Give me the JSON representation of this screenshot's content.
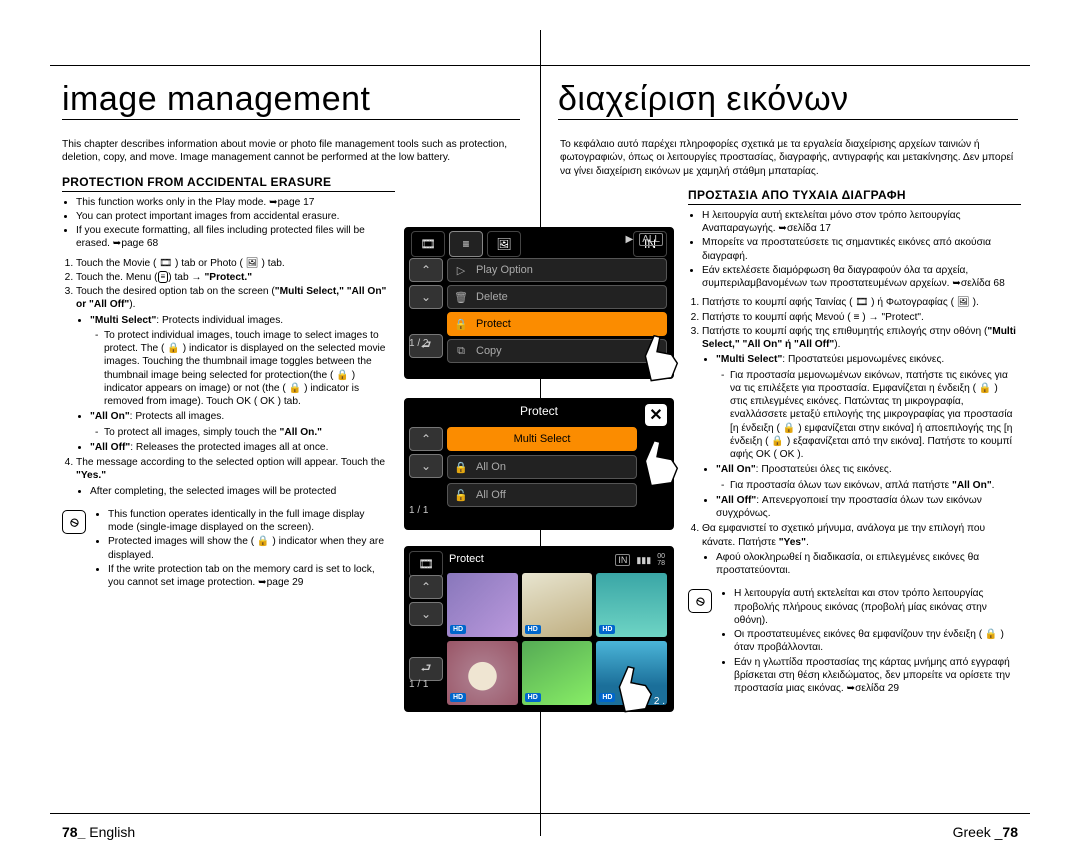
{
  "left": {
    "rootTitle": "image management",
    "intro": "This chapter describes information about movie or photo file management tools such as protection, deletion, copy, and move. Image management cannot be performed at the low battery.",
    "section": "PROTECTION FROM ACCIDENTAL ERASURE",
    "b1": "This function works only in the Play mode. ➥page 17",
    "b2": "You can protect important images from accidental erasure.",
    "b3": "If you execute formatting, all files including protected files will be erased. ➥page 68",
    "n1": "Touch the Movie ( 🎞 ) tab or Photo ( 🖼 ) tab.",
    "n2_a": "Touch the. Menu (",
    "n2_b": ") tab → ",
    "n2_c": "\"Protect.\"",
    "n3_a": "Touch the desired option tab on the screen (",
    "n3_b": "\"Multi Select,\" \"All On\" or \"All Off\"",
    "n3_c": ").",
    "ms_t": "\"Multi Select\"",
    "ms_d": ": Protects individual images.",
    "ms_s1": "To protect individual images, touch image to select images to protect. The ( 🔒 ) indicator is displayed on the selected movie images. Touching the thumbnail image toggles between the thumbnail image being selected for protection(the ( 🔒 ) indicator appears on image) or not (the ( 🔒 ) indicator is removed from image). Touch OK ( OK ) tab.",
    "ao_t": "\"All On\"",
    "ao_d": ": Protects all images.",
    "ao_s1": "To protect all images, simply touch the \"All On.\"",
    "af_t": "\"All Off\"",
    "af_d": ": Releases the protected images all at once.",
    "n4_a": "The message according to the selected option will appear. Touch the ",
    "n4_b": "\"Yes.\"",
    "n4_s1": "After completing, the selected images will be protected",
    "note1": "This function operates identically in the full image display mode (single-image displayed on the screen).",
    "note2": "Protected images will show the ( 🔒 ) indicator when they are displayed.",
    "note3": "If the write protection tab on the memory card is set to lock, you cannot set image protection. ➥page 29",
    "pageNo": "78_",
    "pageLang": " English"
  },
  "right": {
    "rootTitle": "διαχείριση εικόνων",
    "intro": "Το κεφάλαιο αυτό παρέχει πληροφορίες σχετικά με τα εργαλεία διαχείρισης αρχείων ταινιών ή φωτογραφιών, όπως οι λειτουργίες προστασίας, διαγραφής, αντιγραφής και μετακίνησης. Δεν μπορεί να γίνει διαχείριση εικόνων με χαμηλή στάθμη μπαταρίας.",
    "section": "ΠΡΟΣΤΑΣΙΑ ΑΠΟ ΤΥΧΑΙΑ ΔΙΑΓΡΑΦΗ",
    "b1": "Η λειτουργία αυτή εκτελείται μόνο στον τρόπο λειτουργίας Αναπαραγωγής. ➥σελίδα 17",
    "b2": "Μπορείτε να προστατεύσετε τις σημαντικές εικόνες από ακούσια διαγραφή.",
    "b3": "Εάν εκτελέσετε διαμόρφωση θα διαγραφούν όλα τα αρχεία, συμπεριλαμβανομένων των προστατευμένων αρχείων. ➥σελίδα 68",
    "n1": "Πατήστε το κουμπί αφής Ταινίας ( 🎞 ) ή Φωτογραφίας ( 🖼 ).",
    "n2": "Πατήστε το κουμπί αφής Μενού ( ≡ ) → \"Protect\".",
    "n3_a": "Πατήστε το κουμπί αφής της επιθυμητής επιλογής στην οθόνη (",
    "n3_b": "\"Multi Select,\" \"All On\" ή \"All Off\"",
    "n3_c": ").",
    "ms_t": "\"Multi Select\"",
    "ms_d": ": Προστατεύει μεμονωμένες εικόνες.",
    "ms_s1": "Για προστασία μεμονωμένων εικόνων, πατήστε τις εικόνες για να τις επιλέξετε για προστασία. Εμφανίζεται η ένδειξη ( 🔒 ) στις επιλεγμένες εικόνες. Πατώντας τη μικρογραφία, εναλλάσσετε μεταξύ επιλογής της μικρογραφίας για προστασία [η ένδειξη ( 🔒 ) εμφανίζεται στην εικόνα] ή αποεπιλογής της [η ένδειξη ( 🔒 ) εξαφανίζεται από την εικόνα]. Πατήστε το κουμπί αφής OK ( OK ).",
    "ao_t": "\"All On\"",
    "ao_d": ": Προστατεύει όλες τις εικόνες.",
    "ao_s1": "Για προστασία όλων των εικόνων, απλά πατήστε \"All On\".",
    "af_t": "\"All Off\"",
    "af_d": ": Απενεργοποιεί την προστασία όλων των εικόνων συγχρόνως.",
    "n4_a": "Θα εμφανιστεί το σχετικό μήνυμα, ανάλογα με την επιλογή που κάνατε. Πατήστε ",
    "n4_b": "\"Yes\"",
    "n4_c": ".",
    "n4_s1": "Αφού ολοκληρωθεί η διαδικασία, οι επιλεγμένες εικόνες θα προστατεύονται.",
    "note1": "Η λειτουργία αυτή εκτελείται και στον τρόπο λειτουργίας προβολής πλήρους εικόνας (προβολή μίας εικόνας στην οθόνη).",
    "note2": "Οι προστατευμένες εικόνες θα εμφανίζουν την ένδειξη ( 🔒 ) όταν προβάλλονται.",
    "note3": "Εάν η γλωττίδα προστασίας της κάρτας μνήμης από εγγραφή βρίσκεται στη θέση κλειδώματος, δεν μπορείτε να ορίσετε την προστασία μιας εικόνας. ➥σελίδα 29",
    "pageLang": "Greek _",
    "pageNo": "78"
  },
  "sim1": {
    "pager": "1 / 2",
    "r1": "Play Option",
    "r2": "Delete",
    "r3": "Protect",
    "r4": "Copy"
  },
  "sim2": {
    "title": "Protect",
    "pager": "1 / 1",
    "o1": "Multi Select",
    "o2": "All On",
    "o3": "All Off"
  },
  "sim3": {
    "title": "Protect",
    "pager": "1 / 1",
    "counter": "2 .",
    "hd": "HD",
    "time": "00\n78"
  }
}
